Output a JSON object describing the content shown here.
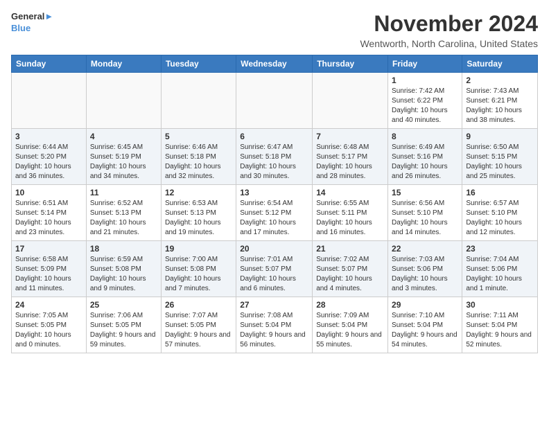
{
  "logo": {
    "line1": "General",
    "line2": "Blue"
  },
  "title": "November 2024",
  "location": "Wentworth, North Carolina, United States",
  "days_of_week": [
    "Sunday",
    "Monday",
    "Tuesday",
    "Wednesday",
    "Thursday",
    "Friday",
    "Saturday"
  ],
  "weeks": [
    [
      {
        "day": "",
        "info": ""
      },
      {
        "day": "",
        "info": ""
      },
      {
        "day": "",
        "info": ""
      },
      {
        "day": "",
        "info": ""
      },
      {
        "day": "",
        "info": ""
      },
      {
        "day": "1",
        "info": "Sunrise: 7:42 AM\nSunset: 6:22 PM\nDaylight: 10 hours and 40 minutes."
      },
      {
        "day": "2",
        "info": "Sunrise: 7:43 AM\nSunset: 6:21 PM\nDaylight: 10 hours and 38 minutes."
      }
    ],
    [
      {
        "day": "3",
        "info": "Sunrise: 6:44 AM\nSunset: 5:20 PM\nDaylight: 10 hours and 36 minutes."
      },
      {
        "day": "4",
        "info": "Sunrise: 6:45 AM\nSunset: 5:19 PM\nDaylight: 10 hours and 34 minutes."
      },
      {
        "day": "5",
        "info": "Sunrise: 6:46 AM\nSunset: 5:18 PM\nDaylight: 10 hours and 32 minutes."
      },
      {
        "day": "6",
        "info": "Sunrise: 6:47 AM\nSunset: 5:18 PM\nDaylight: 10 hours and 30 minutes."
      },
      {
        "day": "7",
        "info": "Sunrise: 6:48 AM\nSunset: 5:17 PM\nDaylight: 10 hours and 28 minutes."
      },
      {
        "day": "8",
        "info": "Sunrise: 6:49 AM\nSunset: 5:16 PM\nDaylight: 10 hours and 26 minutes."
      },
      {
        "day": "9",
        "info": "Sunrise: 6:50 AM\nSunset: 5:15 PM\nDaylight: 10 hours and 25 minutes."
      }
    ],
    [
      {
        "day": "10",
        "info": "Sunrise: 6:51 AM\nSunset: 5:14 PM\nDaylight: 10 hours and 23 minutes."
      },
      {
        "day": "11",
        "info": "Sunrise: 6:52 AM\nSunset: 5:13 PM\nDaylight: 10 hours and 21 minutes."
      },
      {
        "day": "12",
        "info": "Sunrise: 6:53 AM\nSunset: 5:13 PM\nDaylight: 10 hours and 19 minutes."
      },
      {
        "day": "13",
        "info": "Sunrise: 6:54 AM\nSunset: 5:12 PM\nDaylight: 10 hours and 17 minutes."
      },
      {
        "day": "14",
        "info": "Sunrise: 6:55 AM\nSunset: 5:11 PM\nDaylight: 10 hours and 16 minutes."
      },
      {
        "day": "15",
        "info": "Sunrise: 6:56 AM\nSunset: 5:10 PM\nDaylight: 10 hours and 14 minutes."
      },
      {
        "day": "16",
        "info": "Sunrise: 6:57 AM\nSunset: 5:10 PM\nDaylight: 10 hours and 12 minutes."
      }
    ],
    [
      {
        "day": "17",
        "info": "Sunrise: 6:58 AM\nSunset: 5:09 PM\nDaylight: 10 hours and 11 minutes."
      },
      {
        "day": "18",
        "info": "Sunrise: 6:59 AM\nSunset: 5:08 PM\nDaylight: 10 hours and 9 minutes."
      },
      {
        "day": "19",
        "info": "Sunrise: 7:00 AM\nSunset: 5:08 PM\nDaylight: 10 hours and 7 minutes."
      },
      {
        "day": "20",
        "info": "Sunrise: 7:01 AM\nSunset: 5:07 PM\nDaylight: 10 hours and 6 minutes."
      },
      {
        "day": "21",
        "info": "Sunrise: 7:02 AM\nSunset: 5:07 PM\nDaylight: 10 hours and 4 minutes."
      },
      {
        "day": "22",
        "info": "Sunrise: 7:03 AM\nSunset: 5:06 PM\nDaylight: 10 hours and 3 minutes."
      },
      {
        "day": "23",
        "info": "Sunrise: 7:04 AM\nSunset: 5:06 PM\nDaylight: 10 hours and 1 minute."
      }
    ],
    [
      {
        "day": "24",
        "info": "Sunrise: 7:05 AM\nSunset: 5:05 PM\nDaylight: 10 hours and 0 minutes."
      },
      {
        "day": "25",
        "info": "Sunrise: 7:06 AM\nSunset: 5:05 PM\nDaylight: 9 hours and 59 minutes."
      },
      {
        "day": "26",
        "info": "Sunrise: 7:07 AM\nSunset: 5:05 PM\nDaylight: 9 hours and 57 minutes."
      },
      {
        "day": "27",
        "info": "Sunrise: 7:08 AM\nSunset: 5:04 PM\nDaylight: 9 hours and 56 minutes."
      },
      {
        "day": "28",
        "info": "Sunrise: 7:09 AM\nSunset: 5:04 PM\nDaylight: 9 hours and 55 minutes."
      },
      {
        "day": "29",
        "info": "Sunrise: 7:10 AM\nSunset: 5:04 PM\nDaylight: 9 hours and 54 minutes."
      },
      {
        "day": "30",
        "info": "Sunrise: 7:11 AM\nSunset: 5:04 PM\nDaylight: 9 hours and 52 minutes."
      }
    ]
  ]
}
